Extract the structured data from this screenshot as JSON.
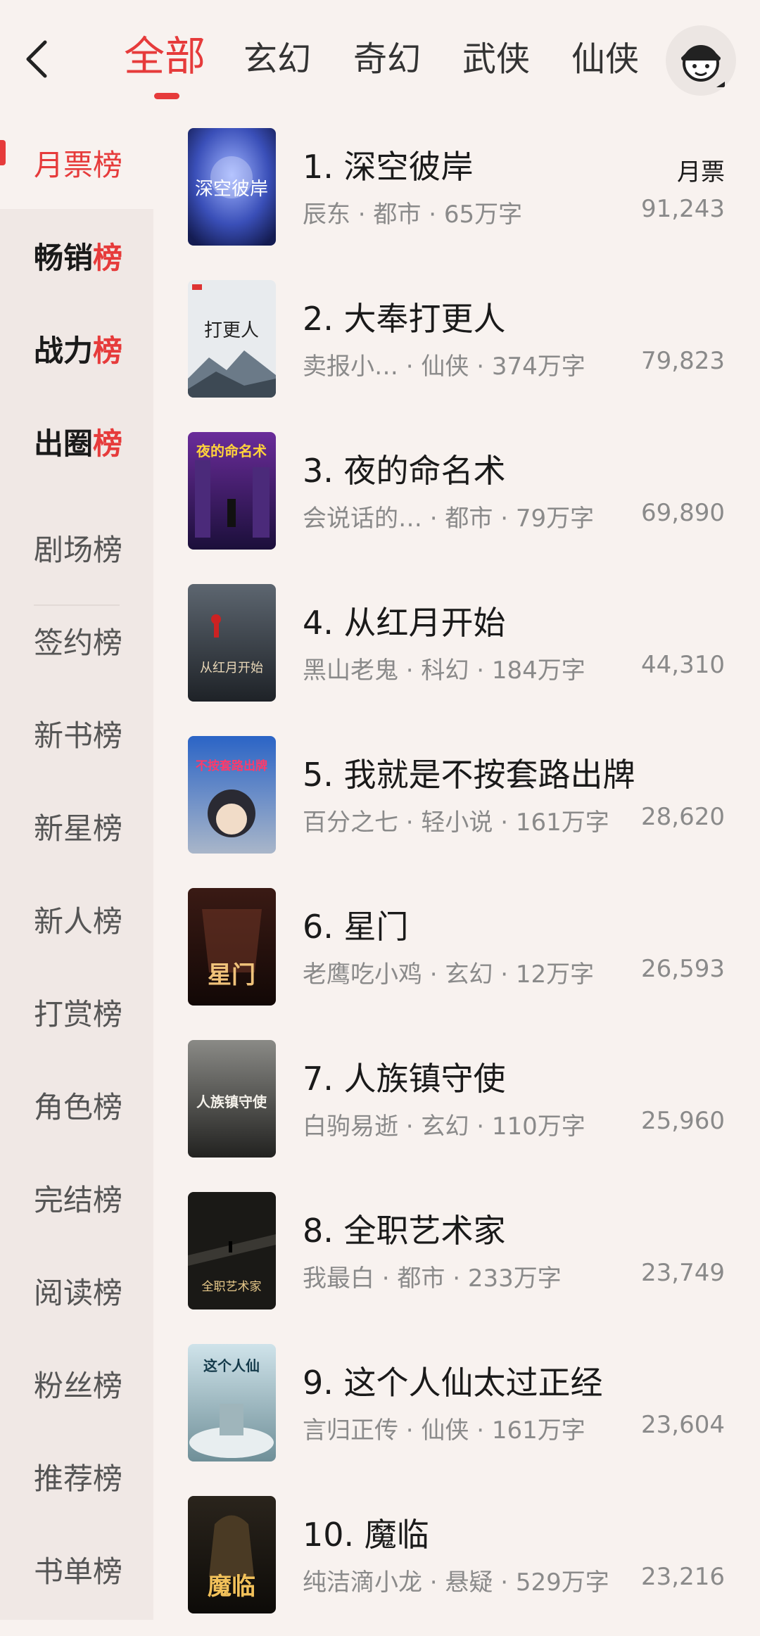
{
  "header": {
    "tabs": [
      {
        "label": "全部",
        "active": true
      },
      {
        "label": "玄幻"
      },
      {
        "label": "奇幻"
      },
      {
        "label": "武侠"
      },
      {
        "label": "仙侠"
      }
    ]
  },
  "sidebar": {
    "items": [
      {
        "label": "月票",
        "suffix": "榜"
      },
      {
        "label": "畅销",
        "suffix": "榜"
      },
      {
        "label": "战力",
        "suffix": "榜"
      },
      {
        "label": "出圈",
        "suffix": "榜"
      },
      {
        "label": "剧场榜"
      },
      {
        "label": "签约榜"
      },
      {
        "label": "新书榜"
      },
      {
        "label": "新星榜"
      },
      {
        "label": "新人榜"
      },
      {
        "label": "打赏榜"
      },
      {
        "label": "角色榜"
      },
      {
        "label": "完结榜"
      },
      {
        "label": "阅读榜"
      },
      {
        "label": "粉丝榜"
      },
      {
        "label": "推荐榜"
      },
      {
        "label": "书单榜"
      }
    ]
  },
  "list": {
    "vote_label": "月票",
    "books": [
      {
        "title": "1. 深空彼岸",
        "meta": "辰东 · 都市 · 65万字",
        "votes": "91,243",
        "cover_text": "深空彼岸"
      },
      {
        "title": "2. 大奉打更人",
        "meta": "卖报小…   · 仙侠 · 374万字",
        "votes": "79,823",
        "cover_text": "打更人"
      },
      {
        "title": "3. 夜的命名术",
        "meta": "会说话的…  · 都市 · 79万字",
        "votes": "69,890",
        "cover_text": "夜的命名术"
      },
      {
        "title": "4. 从红月开始",
        "meta": "黑山老鬼 · 科幻 · 184万字",
        "votes": "44,310",
        "cover_text": "从红月开始"
      },
      {
        "title": "5. 我就是不按套路出牌",
        "meta": "百分之七 · 轻小说 · 161万字",
        "votes": "28,620",
        "cover_text": "不按套路出牌"
      },
      {
        "title": "6. 星门",
        "meta": "老鹰吃小鸡 · 玄幻 · 12万字",
        "votes": "26,593",
        "cover_text": "星门"
      },
      {
        "title": "7. 人族镇守使",
        "meta": "白驹易逝 · 玄幻 · 110万字",
        "votes": "25,960",
        "cover_text": "人族镇守使"
      },
      {
        "title": "8. 全职艺术家",
        "meta": "我最白 · 都市 · 233万字",
        "votes": "23,749",
        "cover_text": "全职艺术家"
      },
      {
        "title": "9. 这个人仙太过正经",
        "meta": "言归正传 · 仙侠 · 161万字",
        "votes": "23,604",
        "cover_text": "这个人仙"
      },
      {
        "title": "10. 魔临",
        "meta": "纯洁滴小龙 · 悬疑 · 529万字",
        "votes": "23,216",
        "cover_text": "魔临"
      }
    ]
  },
  "colors": {
    "accent": "#e63b3b",
    "background": "#f8f2ef",
    "sidebar": "#f0e8e5"
  }
}
